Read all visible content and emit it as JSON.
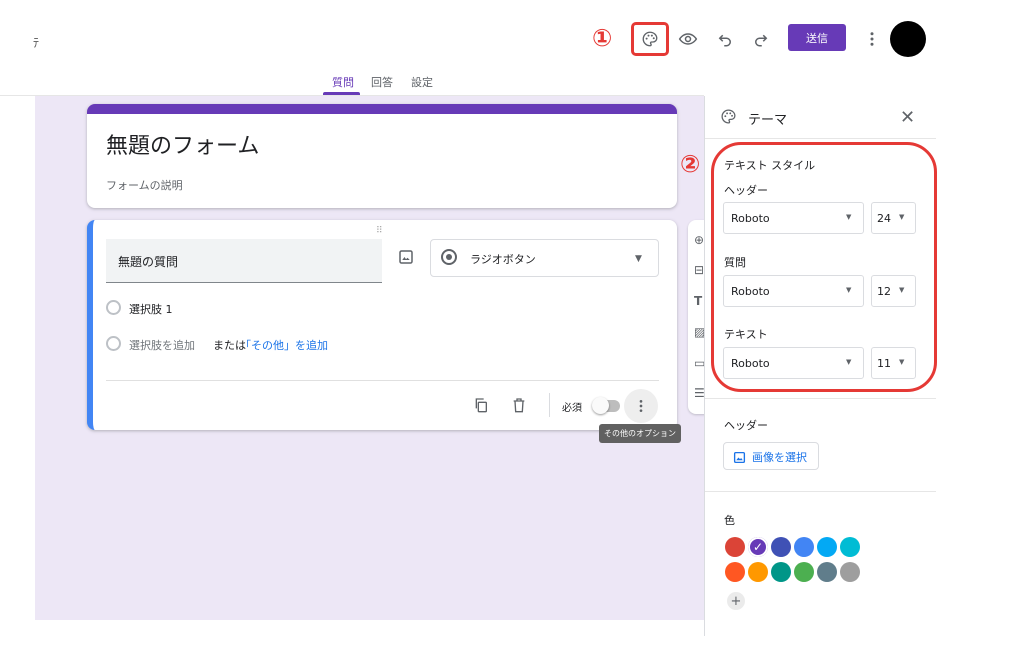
{
  "topbar": {
    "left_char": "ﾃ",
    "annotation_1": "①",
    "annotation_2": "②",
    "send_label": "送信"
  },
  "tabs": [
    {
      "label": "質問",
      "active": true
    },
    {
      "label": "回答",
      "active": false
    },
    {
      "label": "設定",
      "active": false
    }
  ],
  "form": {
    "title": "無題のフォーム",
    "description": "フォームの説明",
    "question": {
      "title": "無題の質問",
      "type": "ラジオボタン",
      "option1": "選択肢 1",
      "add_option": "選択肢を追加",
      "or": "または",
      "add_other": "「その他」を追加",
      "required_label": "必須",
      "required": false,
      "more_tooltip": "その他のオプション"
    }
  },
  "theme_panel": {
    "title": "テーマ",
    "text_style_heading": "テキスト スタイル",
    "header_label": "ヘッダー",
    "header_font": "Roboto",
    "header_size": "24",
    "question_label": "質問",
    "question_font": "Roboto",
    "question_size": "12",
    "text_label": "テキスト",
    "text_font": "Roboto",
    "text_size": "11",
    "header_image_label": "ヘッダー",
    "choose_image_label": "画像を選択",
    "color_label": "色",
    "colors_row1": [
      "#db4437",
      "#673ab7",
      "#3f51b5",
      "#4285f4",
      "#03a9f4",
      "#00bcd4"
    ],
    "colors_row2": [
      "#ff5722",
      "#ff9800",
      "#009688",
      "#4caf50",
      "#607d8b",
      "#9e9e9e"
    ],
    "selected_color": "#673ab7",
    "annotation_color": "#e53935"
  },
  "icons": [
    "palette-icon",
    "eye-icon",
    "undo-icon",
    "redo-icon",
    "more-vert-icon",
    "close-icon",
    "image-icon",
    "copy-icon",
    "trash-icon",
    "plus-icon"
  ]
}
